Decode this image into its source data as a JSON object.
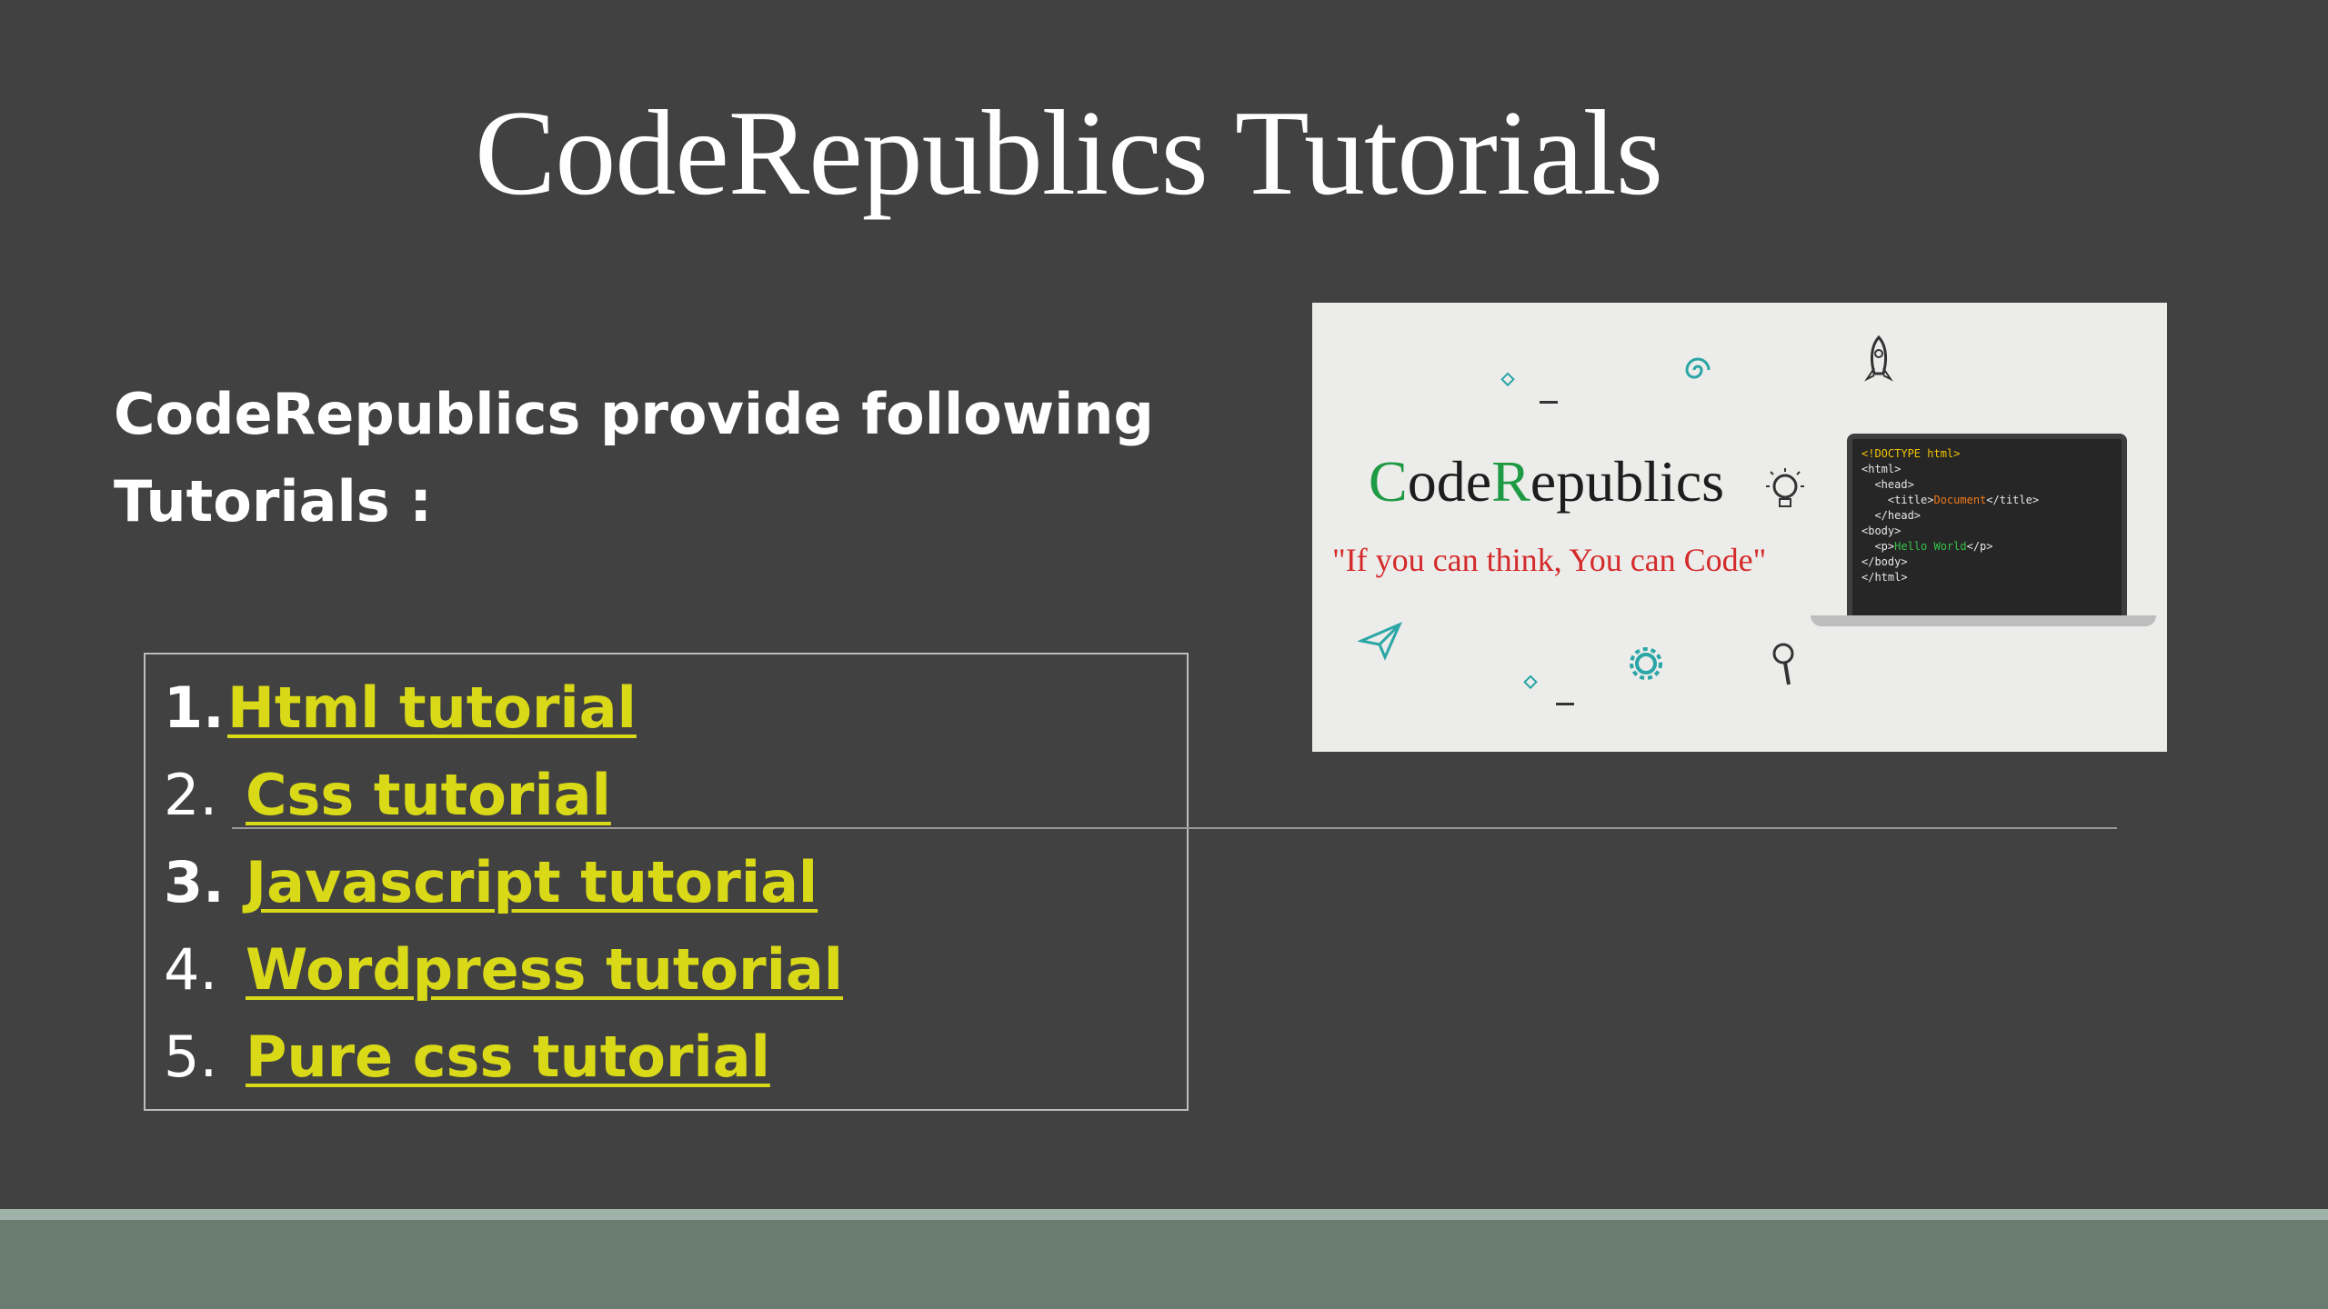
{
  "slide": {
    "title": "CodeRepublics Tutorials",
    "intro_line1": "CodeRepublics provide following",
    "intro_line2": "Tutorials :"
  },
  "tutorials": [
    {
      "number": "1.",
      "label": "Html tutorial"
    },
    {
      "number": "2.",
      "label": "Css tutorial"
    },
    {
      "number": "3.",
      "label": "Javascript tutorial"
    },
    {
      "number": "4.",
      "label": "Wordpress tutorial"
    },
    {
      "number": "5.",
      "label": "Pure css tutorial"
    }
  ],
  "promo": {
    "brand_c": "C",
    "brand_ode": "ode",
    "brand_r": "R",
    "brand_epublics": "epublics",
    "slogan": "\"If you can think, You can Code\"",
    "code": {
      "l1": "<!DOCTYPE html>",
      "l2": "<html>",
      "l3": "  <head>",
      "l4a": "    <title>",
      "l4b": "Document",
      "l4c": "</title>",
      "l5": "  </head>",
      "l6": "<body>",
      "l7a": "  <p>",
      "l7b": "Hello World",
      "l7c": "</p>",
      "l8": "</body>",
      "l9": "</html>"
    }
  },
  "colors": {
    "background": "#414141",
    "link": "#d9d918",
    "brand_green": "#1e9a44",
    "slogan_red": "#d42a2a",
    "footer": "#6a7b6f"
  }
}
